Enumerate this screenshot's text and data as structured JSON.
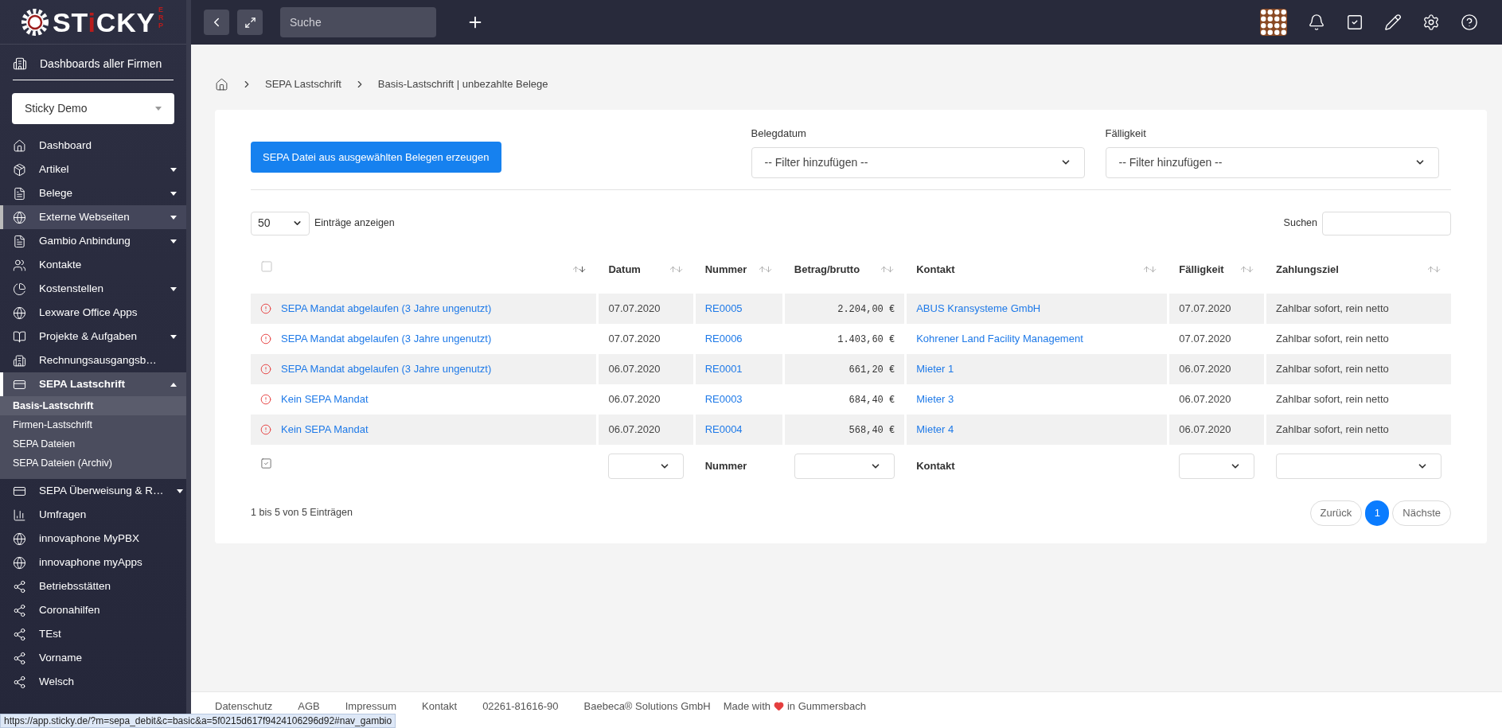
{
  "logo": {
    "before": "ST",
    "accent": "i",
    "after": "CKY",
    "suffix": "ERP"
  },
  "sidebar": {
    "all_dashboards": "Dashboards aller Firmen",
    "company": "Sticky Demo",
    "items": [
      {
        "label": "Dashboard",
        "selected": false,
        "hovered": false
      },
      {
        "label": "Artikel",
        "expanded": false,
        "selected": false,
        "hovered": false
      },
      {
        "label": "Belege",
        "expanded": false,
        "selected": false,
        "hovered": false
      },
      {
        "label": "Externe Webseiten",
        "expanded": false,
        "selected": false,
        "hovered": true
      },
      {
        "label": "Gambio Anbindung",
        "expanded": false,
        "selected": false,
        "hovered": false
      },
      {
        "label": "Kontakte",
        "selected": false,
        "hovered": false
      },
      {
        "label": "Kostenstellen",
        "expanded": false,
        "selected": false,
        "hovered": false
      },
      {
        "label": "Lexware Office Apps",
        "selected": false,
        "hovered": false
      },
      {
        "label": "Projekte & Aufgaben",
        "expanded": false,
        "selected": false,
        "hovered": false
      },
      {
        "label": "Rechnungsausgangsb…",
        "selected": false,
        "hovered": false
      },
      {
        "label": "SEPA Lastschrift",
        "expanded": true,
        "selected": true,
        "hovered": false,
        "children": [
          {
            "label": "Basis-Lastschrift",
            "selected": true
          },
          {
            "label": "Firmen-Lastschrift",
            "selected": false
          },
          {
            "label": "SEPA Dateien",
            "selected": false
          },
          {
            "label": "SEPA Dateien (Archiv)",
            "selected": false
          }
        ]
      },
      {
        "label": "SEPA Überweisung & R…",
        "expanded": false,
        "selected": false,
        "hovered": false
      },
      {
        "label": "Umfragen",
        "selected": false,
        "hovered": false
      },
      {
        "label": "innovaphone MyPBX",
        "selected": false,
        "hovered": false
      },
      {
        "label": "innovaphone myApps",
        "selected": false,
        "hovered": false
      },
      {
        "label": "Betriebsstätten",
        "selected": false,
        "hovered": false
      },
      {
        "label": "Coronahilfen",
        "selected": false,
        "hovered": false
      },
      {
        "label": "TEst",
        "selected": false,
        "hovered": false
      },
      {
        "label": "Vorname",
        "selected": false,
        "hovered": false
      },
      {
        "label": "Welsch",
        "selected": false,
        "hovered": false
      }
    ]
  },
  "topbar": {
    "search_placeholder": "Suche"
  },
  "breadcrumb": [
    "SEPA Lastschrift",
    "Basis-Lastschrift | unbezahlte Belege"
  ],
  "create_button": "SEPA Datei aus ausgewählten Belegen erzeugen",
  "filters": [
    {
      "label": "Belegdatum",
      "value": "-- Filter hinzufügen --"
    },
    {
      "label": "Fälligkeit",
      "value": "-- Filter hinzufügen --"
    }
  ],
  "page_length": "50",
  "page_length_label": "Einträge anzeigen",
  "search_label": "Suchen",
  "table": {
    "columns": [
      {
        "kind": "checkbox",
        "checked": false,
        "sorted": true
      },
      {
        "kind": "text",
        "label": "Datum",
        "sorted": false
      },
      {
        "kind": "text",
        "label": "Nummer",
        "sorted": false
      },
      {
        "kind": "text",
        "label": "Betrag/brutto",
        "sorted": false
      },
      {
        "kind": "text",
        "label": "Kontakt",
        "sorted": false
      },
      {
        "kind": "text",
        "label": "Fälligkeit",
        "sorted": false
      },
      {
        "kind": "text",
        "label": "Zahlungsziel",
        "sorted": false
      }
    ],
    "rows": [
      {
        "status": "SEPA Mandat abgelaufen (3 Jahre ungenutzt)",
        "date": "07.07.2020",
        "number": "RE0005",
        "amount": "2.204,00 €",
        "contact": "ABUS Kransysteme GmbH",
        "due": "07.07.2020",
        "terms": "Zahlbar sofort, rein netto"
      },
      {
        "status": "SEPA Mandat abgelaufen (3 Jahre ungenutzt)",
        "date": "07.07.2020",
        "number": "RE0006",
        "amount": "1.403,60 €",
        "contact": "Kohrener Land Facility Management",
        "due": "07.07.2020",
        "terms": "Zahlbar sofort, rein netto"
      },
      {
        "status": "SEPA Mandat abgelaufen (3 Jahre ungenutzt)",
        "date": "06.07.2020",
        "number": "RE0001",
        "amount": "661,20 €",
        "contact": "Mieter 1",
        "due": "06.07.2020",
        "terms": "Zahlbar sofort, rein netto"
      },
      {
        "status": "Kein SEPA Mandat",
        "date": "06.07.2020",
        "number": "RE0003",
        "amount": "684,40 €",
        "contact": "Mieter 3",
        "due": "06.07.2020",
        "terms": "Zahlbar sofort, rein netto"
      },
      {
        "status": "Kein SEPA Mandat",
        "date": "06.07.2020",
        "number": "RE0004",
        "amount": "568,40 €",
        "contact": "Mieter 4",
        "due": "06.07.2020",
        "terms": "Zahlbar sofort, rein netto"
      }
    ],
    "footer": [
      {
        "kind": "checkbox",
        "checked": true
      },
      {
        "kind": "select"
      },
      {
        "kind": "label",
        "label": "Nummer"
      },
      {
        "kind": "select"
      },
      {
        "kind": "label",
        "label": "Kontakt"
      },
      {
        "kind": "select"
      },
      {
        "kind": "select"
      }
    ]
  },
  "info": "1 bis 5 von 5 Einträgen",
  "pagination": [
    {
      "label": "Zurück",
      "selected": false
    },
    {
      "label": "1",
      "selected": true
    },
    {
      "label": "Nächste",
      "selected": false
    }
  ],
  "footer_links": [
    "Datenschutz",
    "AGB",
    "Impressum",
    "Kontakt",
    "02261-81616-90",
    "Baebeca® Solutions GmbH"
  ],
  "made_with": {
    "before": "Made with",
    "after": "in Gummersbach"
  },
  "status_url": "https://app.sticky.de/?m=sepa_debit&c=basic&a=5f0215d617f9424106296d92#nav_gambio"
}
